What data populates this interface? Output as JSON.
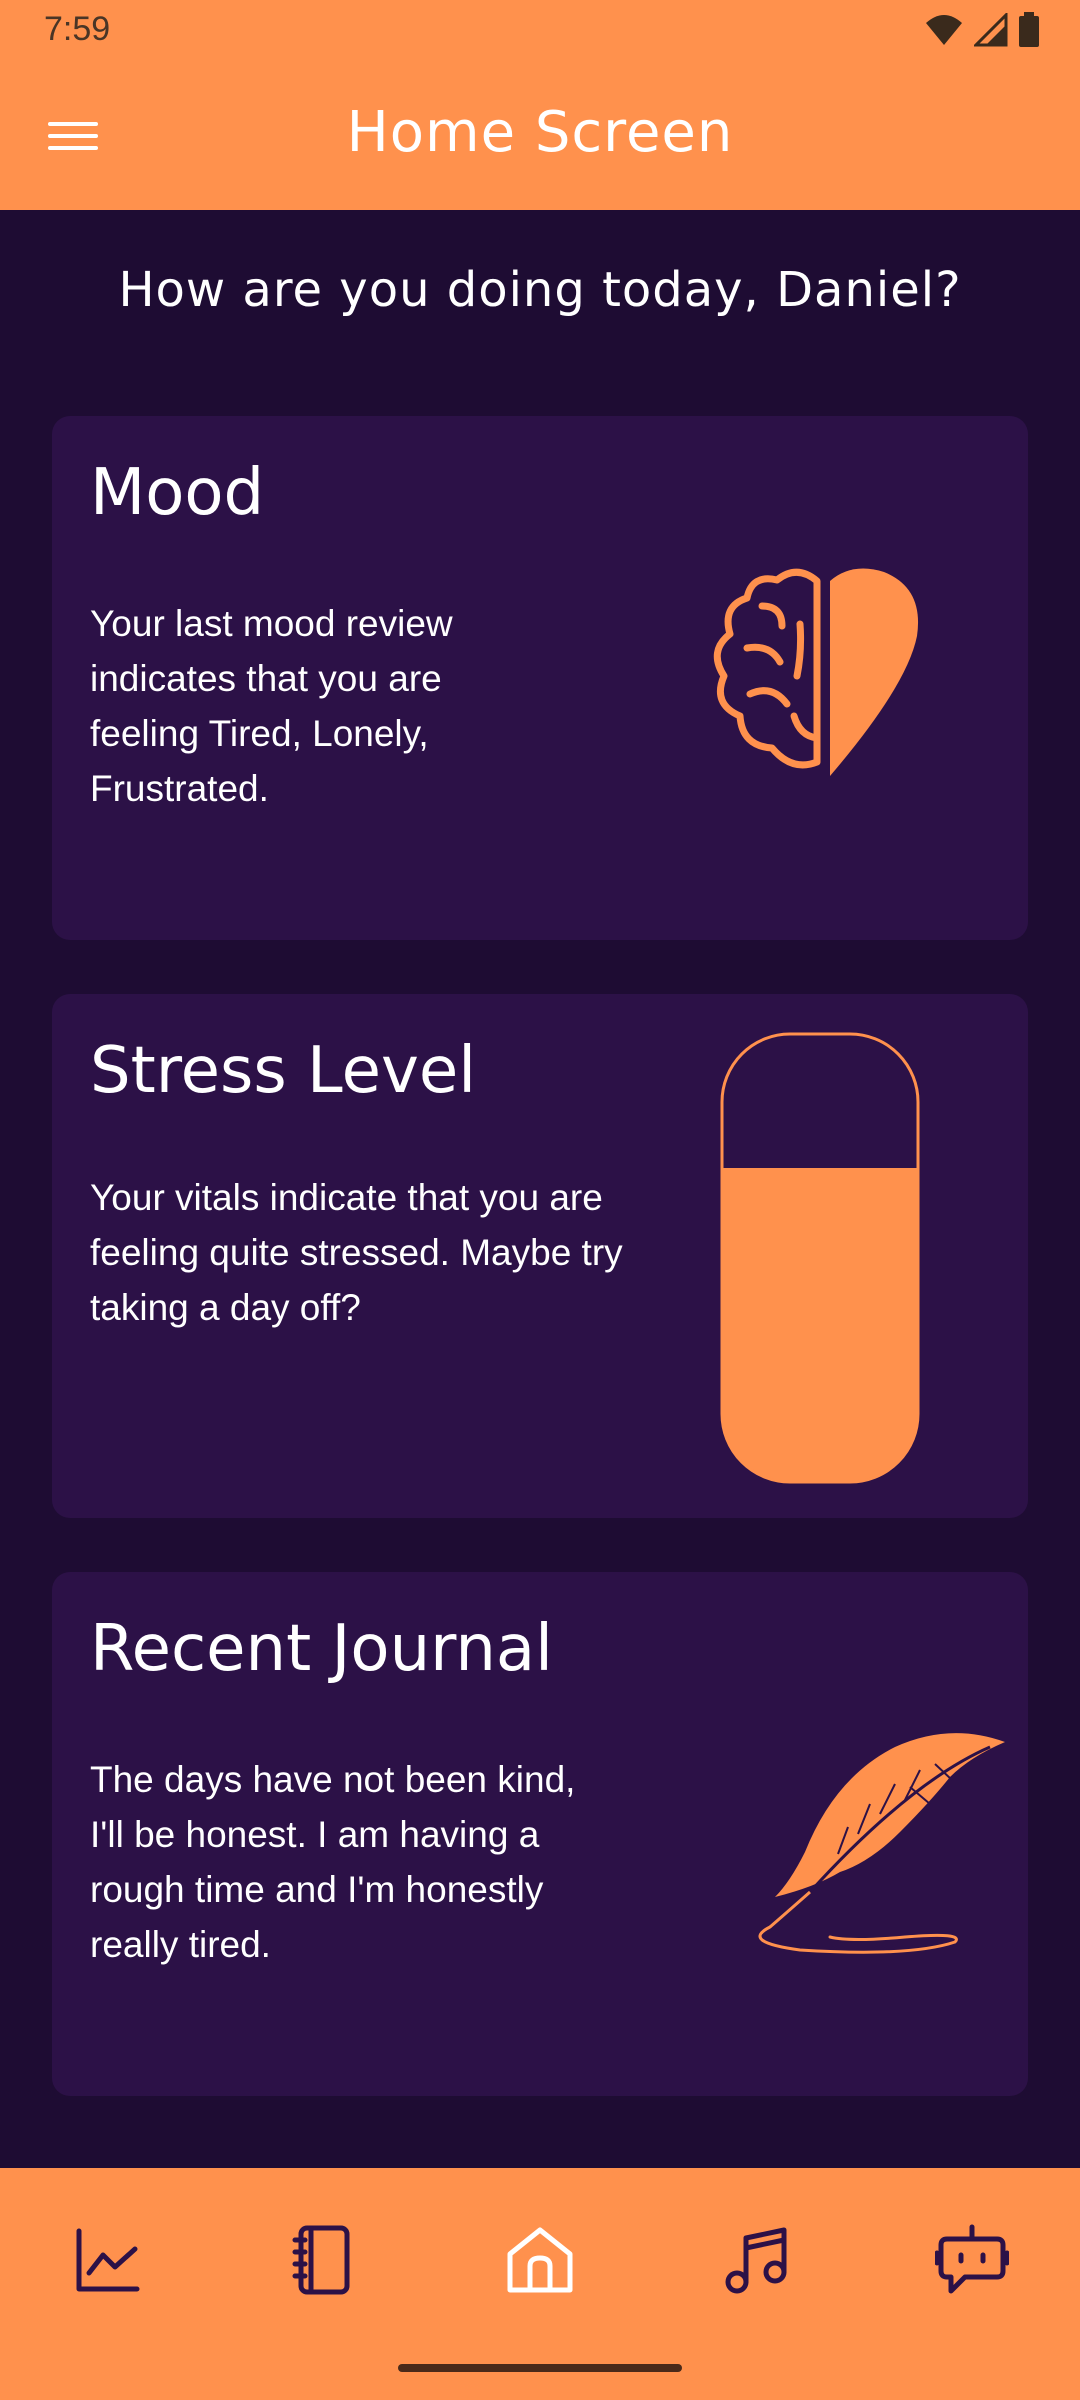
{
  "status_bar": {
    "time": "7:59"
  },
  "app_bar": {
    "title": "Home Screen",
    "menu_icon": "hamburger-menu-icon"
  },
  "greeting": "How are you doing today, Daniel?",
  "cards": {
    "mood": {
      "title": "Mood",
      "text": "Your last mood review indicates that you are feeling Tired, Lonely, Frustrated.",
      "icon": "brain-heart-icon"
    },
    "stress": {
      "title": "Stress Level",
      "text": "Your vitals indicate that you are feeling quite stressed. Maybe try taking a day off?",
      "icon": "stress-level-gauge",
      "level_fraction": 0.7
    },
    "journal": {
      "title": "Recent Journal",
      "text": "The days have not been kind, I'll be honest. I am having a rough time and I'm honestly really tired.",
      "icon": "quill-feather-icon"
    }
  },
  "bottom_nav": {
    "items": [
      {
        "icon": "chart-line-icon"
      },
      {
        "icon": "notebook-icon"
      },
      {
        "icon": "home-icon",
        "active": true
      },
      {
        "icon": "music-note-icon"
      },
      {
        "icon": "chatbot-icon"
      }
    ]
  },
  "colors": {
    "accent": "#ff914d",
    "background": "#1e0c33",
    "card": "#2c1147",
    "text": "#ffffff",
    "nav_icon": "#2c1147",
    "nav_icon_active": "#ffffff"
  }
}
